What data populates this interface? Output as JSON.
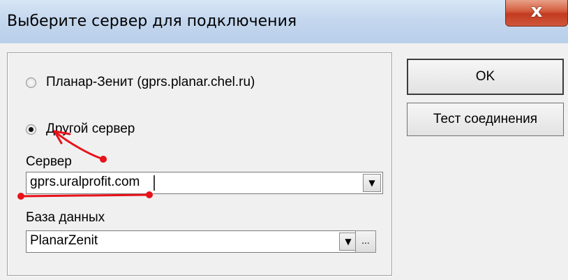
{
  "window": {
    "title": "Выберите сервер для подключения",
    "close_label": "x"
  },
  "connection": {
    "options": [
      {
        "label": "Планар-Зенит (gprs.planar.chel.ru)",
        "selected": false
      },
      {
        "label": "Другой сервер",
        "selected": true
      }
    ],
    "server": {
      "label": "Сервер",
      "value": "gprs.uralprofit.com"
    },
    "database": {
      "label": "База данных",
      "value": "PlanarZenit",
      "browse_label": "..."
    }
  },
  "buttons": {
    "ok": "OK",
    "test": "Тест соединения"
  },
  "colors": {
    "annotation": "#e8121a"
  }
}
